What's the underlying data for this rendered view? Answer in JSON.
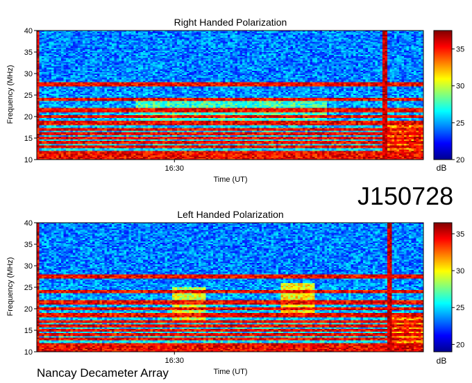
{
  "observation_id": "J150728",
  "instrument": "Nancay Decameter Array",
  "chart_data": [
    {
      "type": "heatmap",
      "title": "Right Handed Polarization",
      "xlabel": "Time (UT)",
      "ylabel": "Frequency (MHz)",
      "x_ticks": [
        "16:30"
      ],
      "ylim": [
        10,
        40
      ],
      "y_ticks": [
        10,
        15,
        20,
        25,
        30,
        35,
        40
      ],
      "colorbar": {
        "label": "dB",
        "range": [
          20,
          37.5
        ],
        "ticks": [
          20,
          25,
          30,
          35
        ]
      },
      "colormap": "jet",
      "strong_bands_mhz": [
        10.5,
        11.5,
        13,
        14,
        15,
        16,
        17,
        18.5,
        20,
        21.5,
        24,
        27.5
      ],
      "broadband_burst_time_fraction": 0.895
    },
    {
      "type": "heatmap",
      "title": "Left Handed Polarization",
      "xlabel": "Time (UT)",
      "ylabel": "Frequency (MHz)",
      "x_ticks": [
        "16:30"
      ],
      "ylim": [
        10,
        40
      ],
      "y_ticks": [
        10,
        15,
        20,
        25,
        30,
        35,
        40
      ],
      "colorbar": {
        "label": "dB",
        "range": [
          19,
          36.5
        ],
        "ticks": [
          20,
          25,
          30,
          35
        ]
      },
      "colormap": "jet",
      "strong_bands_mhz": [
        10.5,
        11.5,
        13,
        14,
        15,
        16,
        17,
        18.5,
        20,
        21.5,
        24,
        27.5
      ],
      "broadband_burst_time_fraction": 0.905
    }
  ]
}
